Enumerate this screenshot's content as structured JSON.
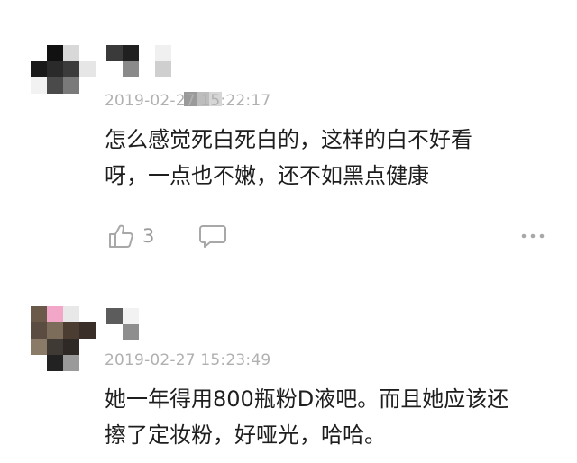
{
  "comments": [
    {
      "timestamp": "2019-02-27 15:22:17",
      "text_lines": [
        "怎么感觉死白死白的，这样的白不好看",
        "呀，一点也不嫩，还不如黑点健康"
      ],
      "like_count": "3"
    },
    {
      "timestamp": "2019-02-27 15:23:49",
      "text_lines": [
        "她一年得用800瓶粉D液吧。而且她应该还",
        "擦了定妆粉，好哑光，哈哈。"
      ]
    }
  ],
  "icons": {
    "like": "thumbs-up-icon",
    "reply": "comment-bubble-icon",
    "more": "more-dots-icon"
  },
  "colors": {
    "timestamp": "#b0b0b0",
    "body_text": "#1e1e1e",
    "icon": "#a8a8a8"
  }
}
